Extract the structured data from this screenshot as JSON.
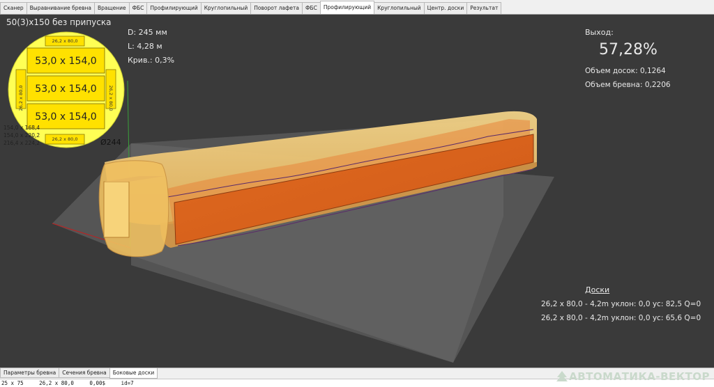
{
  "tabs": [
    {
      "label": "Сканер"
    },
    {
      "label": "Выравнивание бревна"
    },
    {
      "label": "Вращение"
    },
    {
      "label": "ФБС"
    },
    {
      "label": "Профилирующий"
    },
    {
      "label": "Круглопильный"
    },
    {
      "label": "Поворот лафета"
    },
    {
      "label": "ФБС"
    },
    {
      "label": "Профилирующий"
    },
    {
      "label": "Круглопильный"
    },
    {
      "label": "Центр. доски"
    },
    {
      "label": "Результат"
    }
  ],
  "active_tab_index": 8,
  "viewport": {
    "scheme_title": "50(3)x150 без припуска",
    "params": {
      "diameter": "D: 245 мм",
      "length": "L: 4,28 м",
      "curvature": "Крив.: 0,3%"
    },
    "yield": {
      "label": "Выход:",
      "value": "57,28%",
      "boards_volume": "Объем досок: 0,1264",
      "log_volume": "Объем бревна: 0,2206"
    },
    "section": {
      "diameter_label": "Ø244",
      "top_board": "26,2 x 80,0",
      "bottom_board": "26,2 x 80,0",
      "left_board": "26,2 x 80,0",
      "right_board": "26,2 x 80,0",
      "center_boards": [
        "53,0 x 154,0",
        "53,0 x 154,0",
        "53,0 x 154,0"
      ],
      "dims": [
        "154,0 x 168,4",
        "154,0 x 220,2",
        "216,4 x 224,2"
      ]
    },
    "boards": {
      "title": "Доски",
      "rows": [
        "26,2 x 80,0 - 4,2m  уклон: 0,0  ус: 82,5  Q=0",
        "26,2 x 80,0 - 4,2m  уклон: 0,0  ус: 65,6  Q=0"
      ]
    }
  },
  "bottom_tabs": [
    {
      "label": "Параметры бревна"
    },
    {
      "label": "Сечения бревна"
    },
    {
      "label": "Боковые доски"
    }
  ],
  "bottom_active_index": 2,
  "bottom_panel": {
    "line": "25 x 75     26,2 x 80,0     0,00$     id=7"
  },
  "logo": {
    "text": "АВТОМАТИКА-ВЕКТОР",
    "icon": "tree-icon"
  },
  "colors": {
    "viewport_bg": "#3a3a3a",
    "section_yellow": "#ffff55",
    "board_fill": "#ffe100",
    "log_wood": "#f0c060",
    "cut_orange": "#e07020"
  }
}
